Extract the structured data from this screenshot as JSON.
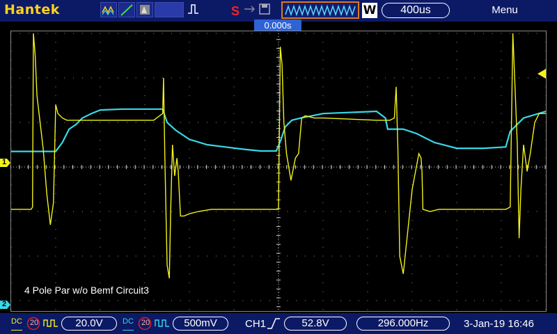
{
  "header": {
    "brand": "Hantek",
    "run_state_icon": "S",
    "timebase": "400us",
    "menu_label": "Menu",
    "window_icon": "W"
  },
  "trigger_position": "0.000s",
  "note": "4 Pole Par w/o Bemf Circuit3",
  "markers": {
    "ch1": "1",
    "ch2": "2"
  },
  "colors": {
    "ch1": "#f2f21a",
    "ch2": "#38d8e8",
    "accent": "#e07a1a"
  },
  "status": {
    "ch1_coupling": "DC",
    "ch1_bw": "20",
    "ch1_scale": "20.0V",
    "ch2_coupling": "DC",
    "ch2_bw": "20",
    "ch2_scale": "500mV",
    "trigger_source": "CH1",
    "trigger_level": "52.8V",
    "frequency": "296.000Hz",
    "datetime": "3-Jan-19 16:46"
  },
  "chart_data": {
    "type": "line",
    "title": "",
    "xlabel": "",
    "ylabel": "",
    "x_unit": "divisions",
    "xlim": [
      -6,
      6
    ],
    "ylim": [
      -3.5,
      3.5
    ],
    "grid": true,
    "series": [
      {
        "x": [
          -6,
          -5.55,
          -5.52,
          -5.5,
          -5.46,
          -5.42,
          -5.35,
          -5.28,
          -5.2,
          -5.12,
          -5.05,
          -5.0,
          -4.95,
          -4.85,
          -4.75,
          -4.6,
          -4.4,
          -2.8,
          -2.6,
          -2.58,
          -2.55,
          -2.5,
          -2.45,
          -2.42,
          -2.38,
          -2.33,
          -2.28,
          -2.25,
          -2.2,
          -2.12,
          -2.0,
          -1.8,
          -1.5,
          -0.5,
          0.0,
          0.04,
          0.08,
          0.12,
          0.18,
          0.28,
          0.38,
          0.45,
          0.52,
          0.6,
          0.8,
          1.0,
          2.2,
          2.5,
          2.6,
          2.64,
          2.68,
          2.72,
          2.8,
          3.0,
          3.15,
          3.2,
          3.22,
          3.24,
          3.4,
          3.6,
          5.1,
          5.2,
          5.26,
          5.3,
          5.36,
          5.4,
          5.44,
          5.5,
          5.58,
          5.65,
          5.75,
          5.85,
          6.0
        ],
        "y": [
          -0.95,
          -0.95,
          -0.9,
          3.0,
          2.5,
          1.6,
          1.0,
          0.4,
          -0.6,
          -1.3,
          -0.8,
          1.4,
          1.2,
          1.1,
          1.05,
          1.05,
          1.05,
          1.05,
          1.2,
          2.0,
          0.2,
          -2.2,
          -2.5,
          -1.0,
          0.5,
          -0.2,
          0.2,
          -0.1,
          -1.1,
          -1.1,
          -1.05,
          -1.0,
          -0.95,
          -0.95,
          -0.95,
          2.7,
          2.3,
          1.0,
          0.3,
          -0.3,
          0.2,
          0.3,
          1.1,
          1.15,
          1.1,
          1.1,
          1.05,
          1.05,
          1.1,
          1.8,
          0.4,
          -2.0,
          -2.4,
          -0.5,
          0.3,
          0.2,
          -0.1,
          -0.95,
          -1.0,
          -0.95,
          -0.95,
          -0.9,
          3.0,
          2.0,
          0.5,
          -1.6,
          -0.5,
          0.5,
          -0.1,
          0.3,
          1.0,
          1.2,
          1.2
        ]
      },
      {
        "x": [
          -6,
          -5.0,
          -4.85,
          -4.7,
          -4.55,
          -4.4,
          -4.2,
          -4.0,
          -3.5,
          -3.0,
          -2.6,
          -2.5,
          -2.3,
          -2.0,
          -1.6,
          -1.2,
          -0.8,
          -0.4,
          -0.05,
          0.05,
          0.15,
          0.3,
          0.5,
          0.75,
          1.0,
          2.2,
          2.4,
          2.45,
          2.6,
          2.8,
          3.1,
          3.5,
          4.0,
          4.6,
          5.1,
          5.2,
          5.35,
          5.5,
          6.0
        ],
        "y": [
          0.35,
          0.35,
          0.55,
          0.85,
          0.95,
          1.1,
          1.2,
          1.28,
          1.3,
          1.3,
          1.3,
          1.0,
          0.82,
          0.62,
          0.5,
          0.45,
          0.4,
          0.36,
          0.36,
          0.6,
          0.9,
          1.05,
          1.1,
          1.15,
          1.2,
          1.25,
          1.1,
          0.85,
          0.85,
          0.85,
          0.75,
          0.55,
          0.42,
          0.42,
          0.45,
          0.8,
          0.95,
          1.1,
          1.25
        ]
      }
    ]
  }
}
